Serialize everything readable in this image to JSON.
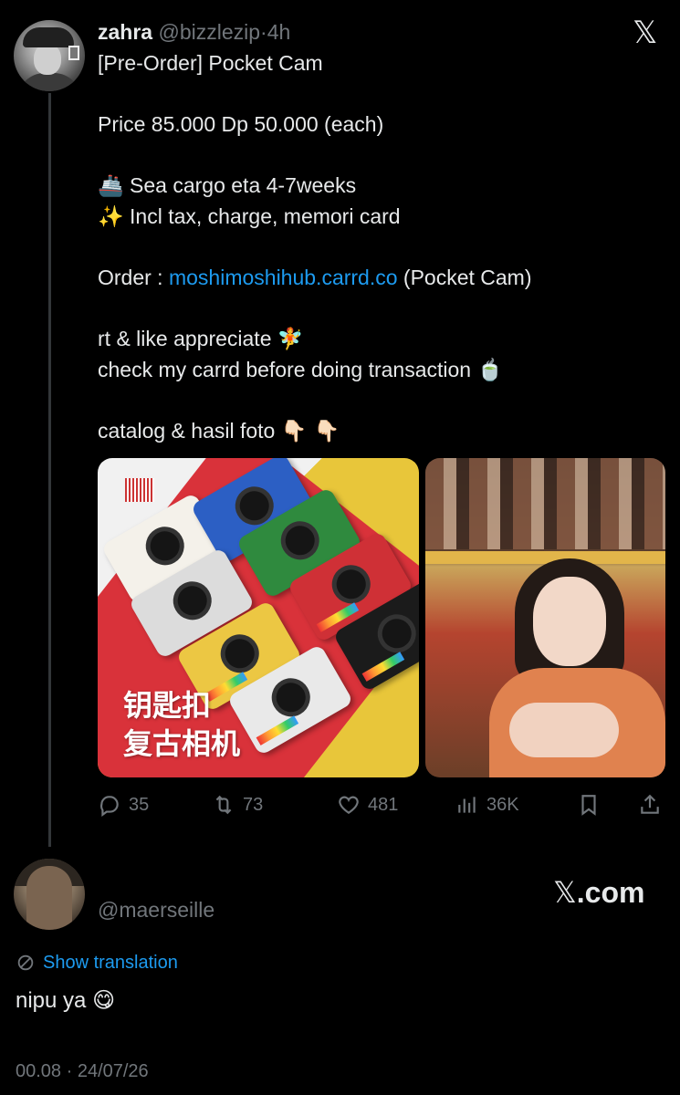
{
  "tweet": {
    "display_name": "zahra",
    "handle": "@bizzlezip",
    "separator": "·",
    "time_ago": "4h",
    "lines": {
      "title": "[Pre-Order] Pocket Cam",
      "price": "Price 85.000 Dp 50.000 (each)",
      "cargo_emoji": "🚢",
      "cargo": "Sea cargo eta 4-7weeks",
      "sparkle_emoji": "✨",
      "incl": "Incl tax, charge, memori card",
      "order_prefix": "Order : ",
      "order_link": "moshimoshihub.carrd.co",
      "order_suffix": " (Pocket Cam)",
      "rt": "rt & like appreciate ",
      "fairy_emoji": "🧚",
      "check": "check my carrd before doing transaction ",
      "tea_emoji": "🍵",
      "catalog": "catalog & hasil foto ",
      "point_emoji": "👇🏻 👇🏻"
    },
    "media": {
      "left_caption_line1": "钥匙扣",
      "left_caption_line2": "复古相机"
    },
    "actions": {
      "replies": "35",
      "retweets": "73",
      "likes": "481",
      "views": "36K"
    }
  },
  "reply": {
    "handle": "@maerseille",
    "show_translation": "Show translation",
    "text": "nipu ya ",
    "text_emoji": "😋",
    "timestamp": "00.08 · 24/07/26"
  },
  "branding": {
    "x_glyph": "𝕏",
    "xcom_glyph": "𝕏",
    "xcom_text": ".com"
  },
  "colors": {
    "background": "#000000",
    "text_primary": "#e7e9ea",
    "text_secondary": "#71767b",
    "link": "#1d9bf0"
  },
  "icons": [
    "reply-icon",
    "retweet-icon",
    "like-icon",
    "views-icon",
    "bookmark-icon",
    "share-icon",
    "translate-icon",
    "x-logo-icon"
  ]
}
